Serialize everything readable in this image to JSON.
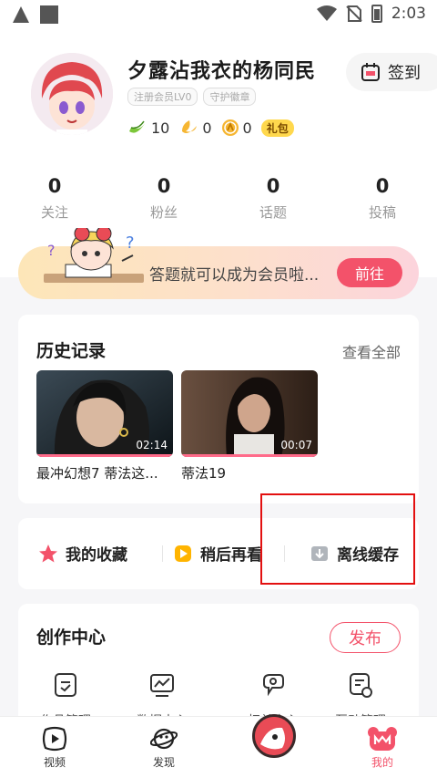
{
  "status_bar": {
    "time": "2:03"
  },
  "profile": {
    "username": "夕露沾我衣的杨同民",
    "tags": [
      "注册会员LV0",
      "守护徽章"
    ],
    "currencies": [
      {
        "icon": "banana-icon",
        "value": "10"
      },
      {
        "icon": "moon-icon",
        "value": "0"
      },
      {
        "icon": "coin-icon",
        "value": "0"
      }
    ],
    "gift_label": "礼包",
    "checkin_label": "签到"
  },
  "counts": [
    {
      "value": "0",
      "label": "关注"
    },
    {
      "value": "0",
      "label": "粉丝"
    },
    {
      "value": "0",
      "label": "话题"
    },
    {
      "value": "0",
      "label": "投稿"
    }
  ],
  "banner": {
    "text": "答题就可以成为会员啦...",
    "button": "前往"
  },
  "history": {
    "title": "历史记录",
    "see_all": "查看全部",
    "items": [
      {
        "title": "最冲幻想7 蒂法这...",
        "duration": "02:14",
        "progress": 1.0
      },
      {
        "title": "蒂法19",
        "duration": "00:07",
        "progress": 1.0
      }
    ]
  },
  "quick_links": [
    {
      "label": "我的收藏",
      "icon": "star-icon",
      "color": "#f3526a"
    },
    {
      "label": "稍后再看",
      "icon": "play-later-icon",
      "color": "#ffb400"
    },
    {
      "label": "离线缓存",
      "icon": "download-icon",
      "color": "#9aa0a6"
    }
  ],
  "creation": {
    "title": "创作中心",
    "publish": "发布",
    "tools": [
      {
        "label": "作品管理",
        "icon": "works-icon"
      },
      {
        "label": "数据中心",
        "icon": "data-icon"
      },
      {
        "label": "权益中心",
        "icon": "rights-icon"
      },
      {
        "label": "互动管理",
        "icon": "interact-icon"
      }
    ]
  },
  "bottom_nav": [
    {
      "label": "视频",
      "icon": "video-icon"
    },
    {
      "label": "发现",
      "icon": "planet-icon"
    },
    {
      "label": "我的",
      "icon": "my-icon",
      "active": true
    }
  ],
  "colors": {
    "accent": "#f3526a",
    "highlight_box": "#e31010"
  }
}
